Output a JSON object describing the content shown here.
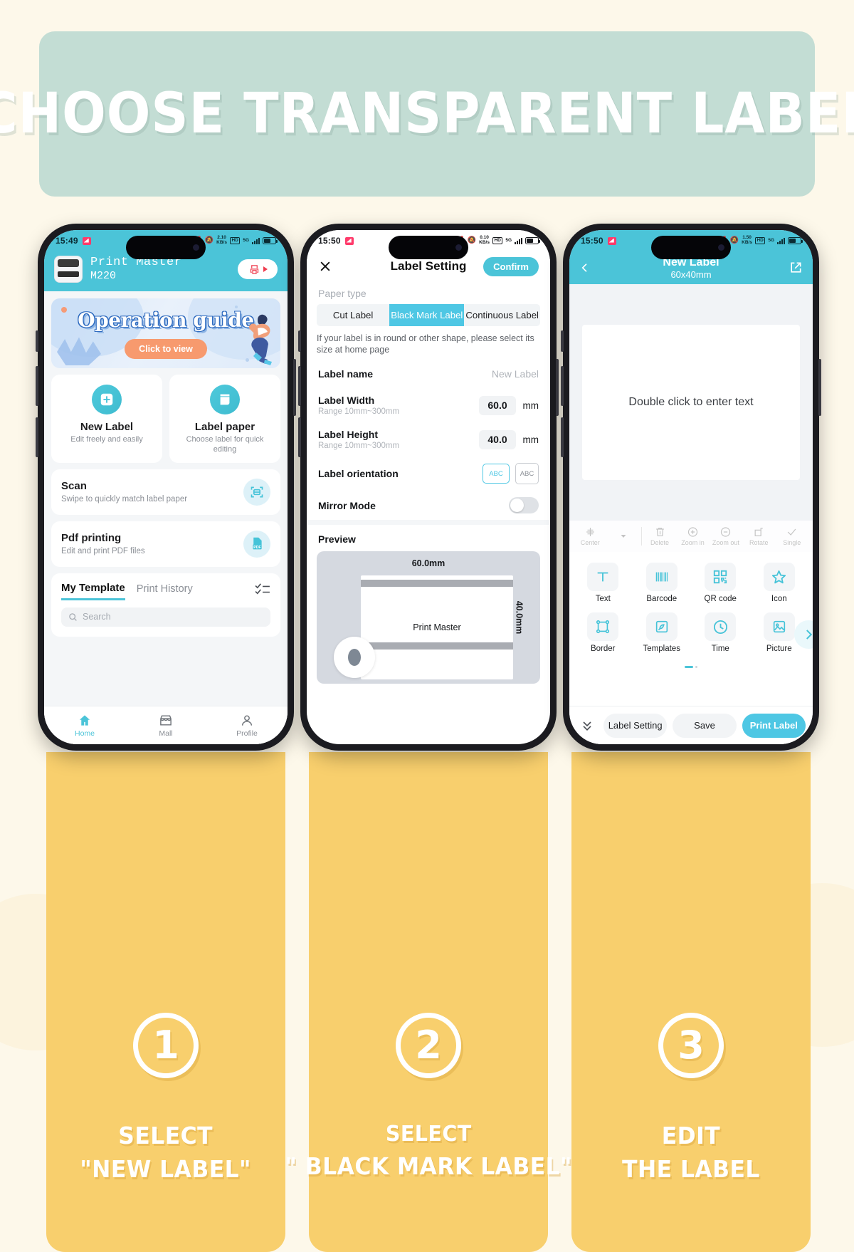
{
  "header": {
    "title": "CHOOSE TRANSPARENT LABEL",
    "bg_color": "#c3ddd4"
  },
  "theme": {
    "accent": "#4bc4d8",
    "accent_alt": "#4ec7e4",
    "panel_yellow": "#f8cf6d",
    "page_bg": "#fdf8ea"
  },
  "phone1": {
    "status": {
      "time": "15:49",
      "data_rate": "2.10",
      "data_unit": "KB/s",
      "hd_badge": "HD",
      "net": "5G"
    },
    "appbar": {
      "title": "Print Master",
      "subtitle": "M220",
      "printer_icon": "printer-icon"
    },
    "guide": {
      "title": "Operation guide",
      "button": "Click to view"
    },
    "tiles": [
      {
        "title": "New Label",
        "subtitle": "Edit freely and easily",
        "icon": "plus-square-icon"
      },
      {
        "title": "Label paper",
        "subtitle": "Choose label for quick editing",
        "icon": "label-roll-icon"
      }
    ],
    "rows": [
      {
        "title": "Scan",
        "subtitle": "Swipe to quickly match label paper",
        "icon": "scan-icon"
      },
      {
        "title": "Pdf printing",
        "subtitle": "Edit and print PDF files",
        "icon": "pdf-icon"
      }
    ],
    "templates": {
      "tabs": [
        "My Template",
        "Print History"
      ],
      "active_tab": "My Template",
      "list_icon": "checklist-icon",
      "search_placeholder": "Search",
      "search_icon": "search-icon"
    },
    "tabbar": [
      {
        "label": "Home",
        "icon": "home-icon",
        "active": true
      },
      {
        "label": "Mall",
        "icon": "store-icon",
        "active": false
      },
      {
        "label": "Profile",
        "icon": "person-icon",
        "active": false
      }
    ]
  },
  "phone2": {
    "status": {
      "time": "15:50",
      "data_rate": "0.10",
      "data_unit": "KB/s",
      "hd_badge": "HD",
      "net": "5G"
    },
    "navbar": {
      "close_icon": "close-icon",
      "title": "Label Setting",
      "confirm": "Confirm"
    },
    "paper_type_label": "Paper type",
    "segments": [
      "Cut Label",
      "Black Mark Label",
      "Continuous Label"
    ],
    "segment_active": "Black Mark Label",
    "hint": "If your label is in round or other shape, please select its size at home page",
    "fields": [
      {
        "label": "Label name",
        "sub": "",
        "value": "New Label",
        "unit": ""
      },
      {
        "label": "Label Width",
        "sub": "Range 10mm~300mm",
        "value": "60.0",
        "unit": "mm"
      },
      {
        "label": "Label Height",
        "sub": "Range 10mm~300mm",
        "value": "40.0",
        "unit": "mm"
      }
    ],
    "orientation": {
      "label": "Label orientation",
      "landscape": "ABC",
      "portrait": "ABC",
      "selected": "landscape"
    },
    "mirror": {
      "label": "Mirror Mode",
      "on": false
    },
    "preview": {
      "label": "Preview",
      "width_text": "60.0mm",
      "height_text": "40.0mm",
      "paper_text": "Print Master"
    }
  },
  "phone3": {
    "status": {
      "time": "15:50",
      "data_rate": "1.50",
      "data_unit": "KB/s",
      "hd_badge": "HD",
      "net": "5G"
    },
    "navbar": {
      "back_icon": "chevron-left-icon",
      "title": "New Label",
      "subtitle": "60x40mm",
      "share_icon": "share-icon"
    },
    "canvas": {
      "placeholder": "Double click to enter text"
    },
    "tools_disabled": [
      {
        "label": "Center",
        "icon": "align-center-icon"
      },
      {
        "label": "Delete",
        "icon": "trash-icon"
      },
      {
        "label": "Zoom in",
        "icon": "zoom-in-icon"
      },
      {
        "label": "Zoom out",
        "icon": "zoom-out-icon"
      },
      {
        "label": "Rotate",
        "icon": "rotate-icon"
      },
      {
        "label": "Single",
        "icon": "check-icon"
      }
    ],
    "tools_grid": [
      {
        "label": "Text",
        "icon": "text-icon"
      },
      {
        "label": "Barcode",
        "icon": "barcode-icon"
      },
      {
        "label": "QR code",
        "icon": "qrcode-icon"
      },
      {
        "label": "Icon",
        "icon": "star-icon"
      },
      {
        "label": "Border",
        "icon": "border-icon"
      },
      {
        "label": "Templates",
        "icon": "templates-icon"
      },
      {
        "label": "Time",
        "icon": "clock-icon"
      },
      {
        "label": "Picture",
        "icon": "image-icon"
      }
    ],
    "next_icon": "chevron-right-icon",
    "bottom": {
      "collapse_icon": "chevrons-down-icon",
      "buttons": [
        "Label Setting",
        "Save",
        "Print Label"
      ],
      "primary": "Print Label"
    }
  },
  "steps": [
    {
      "number": "1",
      "line1": "SELECT",
      "line2": "\"NEW LABEL\""
    },
    {
      "number": "2",
      "line1": "SELECT",
      "line2": "\" BLACK MARK LABEL\""
    },
    {
      "number": "3",
      "line1": "EDIT",
      "line2": "THE LABEL"
    }
  ]
}
